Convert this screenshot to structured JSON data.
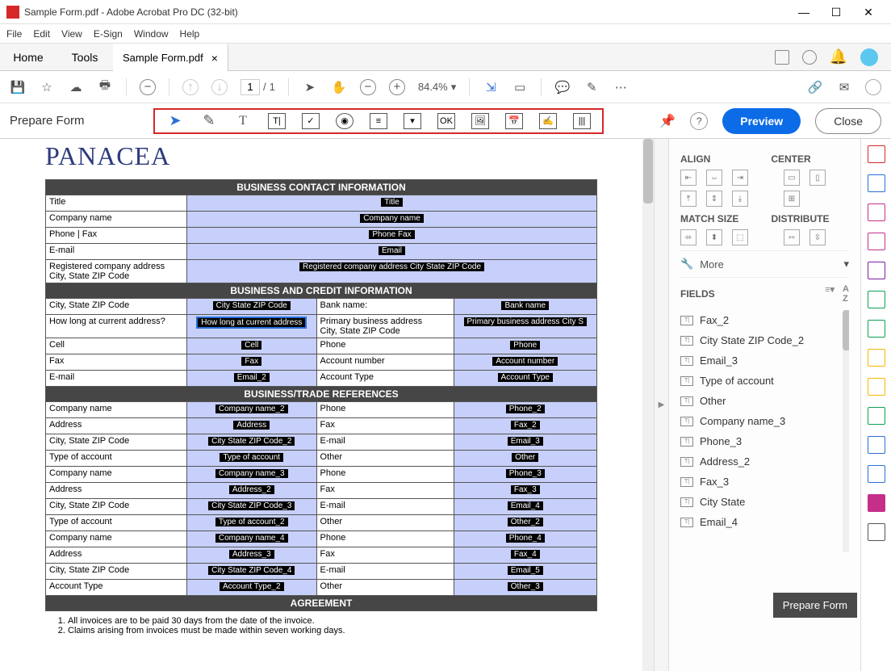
{
  "titlebar": {
    "text": "Sample Form.pdf - Adobe Acrobat Pro DC (32-bit)"
  },
  "menubar": [
    "File",
    "Edit",
    "View",
    "E-Sign",
    "Window",
    "Help"
  ],
  "tabs": {
    "home": "Home",
    "tools": "Tools",
    "doc": "Sample Form.pdf"
  },
  "toolbar2": {
    "page_current": "1",
    "page_total": "1",
    "zoom": "84.4%"
  },
  "prepbar": {
    "label": "Prepare Form",
    "preview": "Preview",
    "close": "Close"
  },
  "doc": {
    "brand": "PANACEA",
    "sections": {
      "s1": "BUSINESS CONTACT INFORMATION",
      "s2": "BUSINESS AND CREDIT INFORMATION",
      "s3": "BUSINESS/TRADE REFERENCES",
      "s4": "AGREEMENT"
    },
    "s1rows": [
      {
        "l": "Title",
        "f": "Title"
      },
      {
        "l": "Company name",
        "f": "Company name"
      },
      {
        "l": "Phone | Fax",
        "f": "Phone  Fax"
      },
      {
        "l": "E-mail",
        "f": "Email"
      },
      {
        "l": "Registered company address\nCity, State ZIP Code",
        "f": "Registered company address City State ZIP Code"
      }
    ],
    "s2rows": [
      {
        "l1": "City, State ZIP Code",
        "f1": "City State ZIP Code",
        "l2": "Bank name:",
        "f2": "Bank name"
      },
      {
        "l1": "How long at current address?",
        "f1": "How long at current address",
        "l2": "Primary business address\nCity, State ZIP Code",
        "f2": "Primary business address City S"
      },
      {
        "l1": "Cell",
        "f1": "Cell",
        "l2": "Phone",
        "f2": "Phone"
      },
      {
        "l1": "Fax",
        "f1": "Fax",
        "l2": "Account number",
        "f2": "Account number"
      },
      {
        "l1": "E-mail",
        "f1": "Email_2",
        "l2": "Account Type",
        "f2": "Account Type"
      }
    ],
    "s3rows": [
      {
        "l1": "Company name",
        "f1": "Company name_2",
        "l2": "Phone",
        "f2": "Phone_2"
      },
      {
        "l1": "Address",
        "f1": "Address",
        "l2": "Fax",
        "f2": "Fax_2"
      },
      {
        "l1": "City, State ZIP Code",
        "f1": "City State ZIP Code_2",
        "l2": "E-mail",
        "f2": "Email_3"
      },
      {
        "l1": "Type of account",
        "f1": "Type of account",
        "l2": "Other",
        "f2": "Other"
      },
      {
        "l1": "Company name",
        "f1": "Company name_3",
        "l2": "Phone",
        "f2": "Phone_3"
      },
      {
        "l1": "Address",
        "f1": "Address_2",
        "l2": "Fax",
        "f2": "Fax_3"
      },
      {
        "l1": "City, State ZIP Code",
        "f1": "City State ZIP Code_3",
        "l2": "E-mail",
        "f2": "Email_4"
      },
      {
        "l1": "Type of account",
        "f1": "Type of account_2",
        "l2": "Other",
        "f2": "Other_2"
      },
      {
        "l1": "Company name",
        "f1": "Company name_4",
        "l2": "Phone",
        "f2": "Phone_4"
      },
      {
        "l1": "Address",
        "f1": "Address_3",
        "l2": "Fax",
        "f2": "Fax_4"
      },
      {
        "l1": "City, State ZIP Code",
        "f1": "City State ZIP Code_4",
        "l2": "E-mail",
        "f2": "Email_5"
      },
      {
        "l1": "Account Type",
        "f1": "Account Type_2",
        "l2": "Other",
        "f2": "Other_3"
      }
    ],
    "agreement": [
      "All invoices are to be paid 30 days from the date of the invoice.",
      "Claims arising from invoices must be made within seven working days."
    ]
  },
  "rpanel": {
    "align": "ALIGN",
    "center": "CENTER",
    "match": "MATCH SIZE",
    "dist": "DISTRIBUTE",
    "more": "More",
    "fields_hdr": "FIELDS",
    "fields": [
      "Fax_2",
      "City State ZIP Code_2",
      "Email_3",
      "Type of account",
      "Other",
      "Company name_3",
      "Phone_3",
      "Address_2",
      "Fax_3",
      "City State",
      "Email_4"
    ]
  },
  "tooltip": "Prepare Form"
}
